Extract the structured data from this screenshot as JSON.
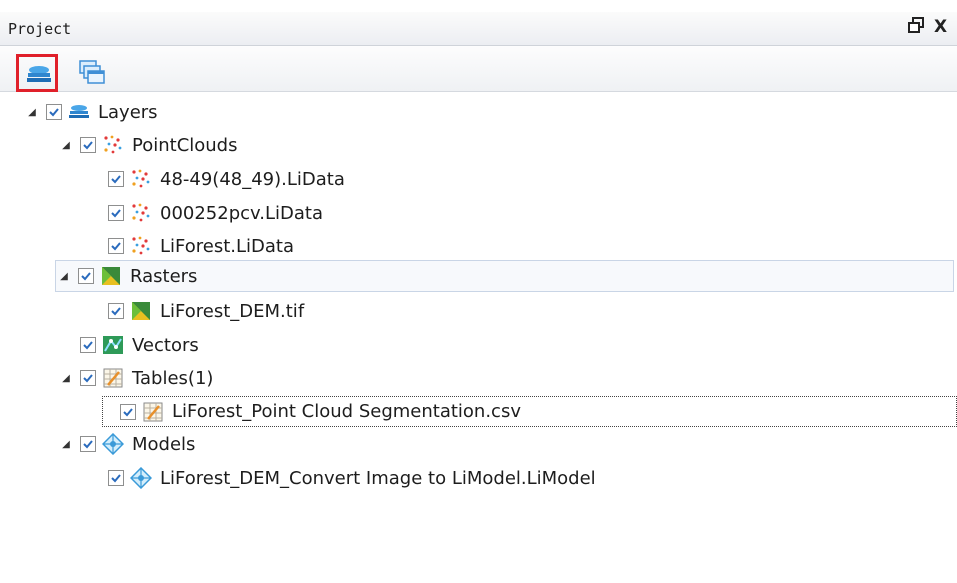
{
  "panel": {
    "title": "Project",
    "pin_glyph": "❐",
    "close_glyph": "X"
  },
  "toolbar": {
    "active_icon": "layers-stack-icon",
    "second_icon": "windows-stack-icon",
    "active_highlight_color": "#e0202a"
  },
  "tree": {
    "layers": "Layers",
    "pointclouds": "PointClouds",
    "pc1": "48-49(48_49).LiData",
    "pc2": "000252pcv.LiData",
    "pc3": "LiForest.LiData",
    "rasters": "Rasters",
    "raster1": "LiForest_DEM.tif",
    "vectors": "Vectors",
    "tables": "Tables(1)",
    "table1": "LiForest_Point Cloud Segmentation.csv",
    "models": "Models",
    "model1": "LiForest_DEM_Convert Image to LiModel.LiModel"
  }
}
